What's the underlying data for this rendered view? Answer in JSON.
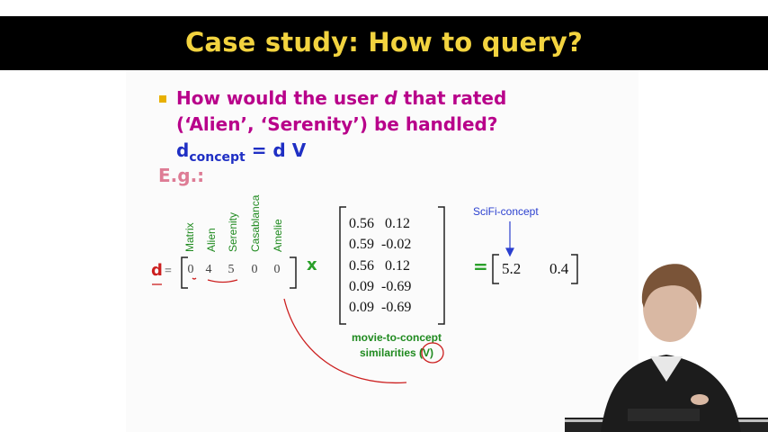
{
  "slide": {
    "title": "Case study: How to query?",
    "question_line1_pre": "How would the user ",
    "question_line1_var": "d",
    "question_line1_post": " that rated",
    "question_line2": "(‘Alien’, ‘Serenity’) be handled?",
    "dconcept_base": "d",
    "dconcept_sub": "concept",
    "dconcept_rhs": " = d V",
    "example_label": "E.g.:"
  },
  "query_vector": {
    "var_label": "d",
    "equals": "=",
    "columns": [
      "Matrix",
      "Alien",
      "Serenity",
      "Casablanca",
      "Amelie"
    ],
    "values": [
      "0",
      "4",
      "5",
      "0",
      "0"
    ]
  },
  "multiply_symbol": "x",
  "matrix_V": {
    "rows": [
      [
        "0.56",
        "0.12"
      ],
      [
        "0.59",
        "-0.02"
      ],
      [
        "0.56",
        "0.12"
      ],
      [
        "0.09",
        "-0.69"
      ],
      [
        "0.09",
        "-0.69"
      ]
    ],
    "caption_line1": "movie-to-concept",
    "caption_line2": "similarities (V)"
  },
  "result": {
    "equals": "=",
    "values": [
      "5.2",
      "0.4"
    ],
    "concept_label": "SciFi-concept"
  },
  "colors": {
    "title": "#f2d33f",
    "question": "#b8008a",
    "dconcept": "#1f2fc4",
    "example": "#de7c95",
    "labels_green": "#1f8a1f",
    "annotation_red": "#cc1f1f"
  }
}
